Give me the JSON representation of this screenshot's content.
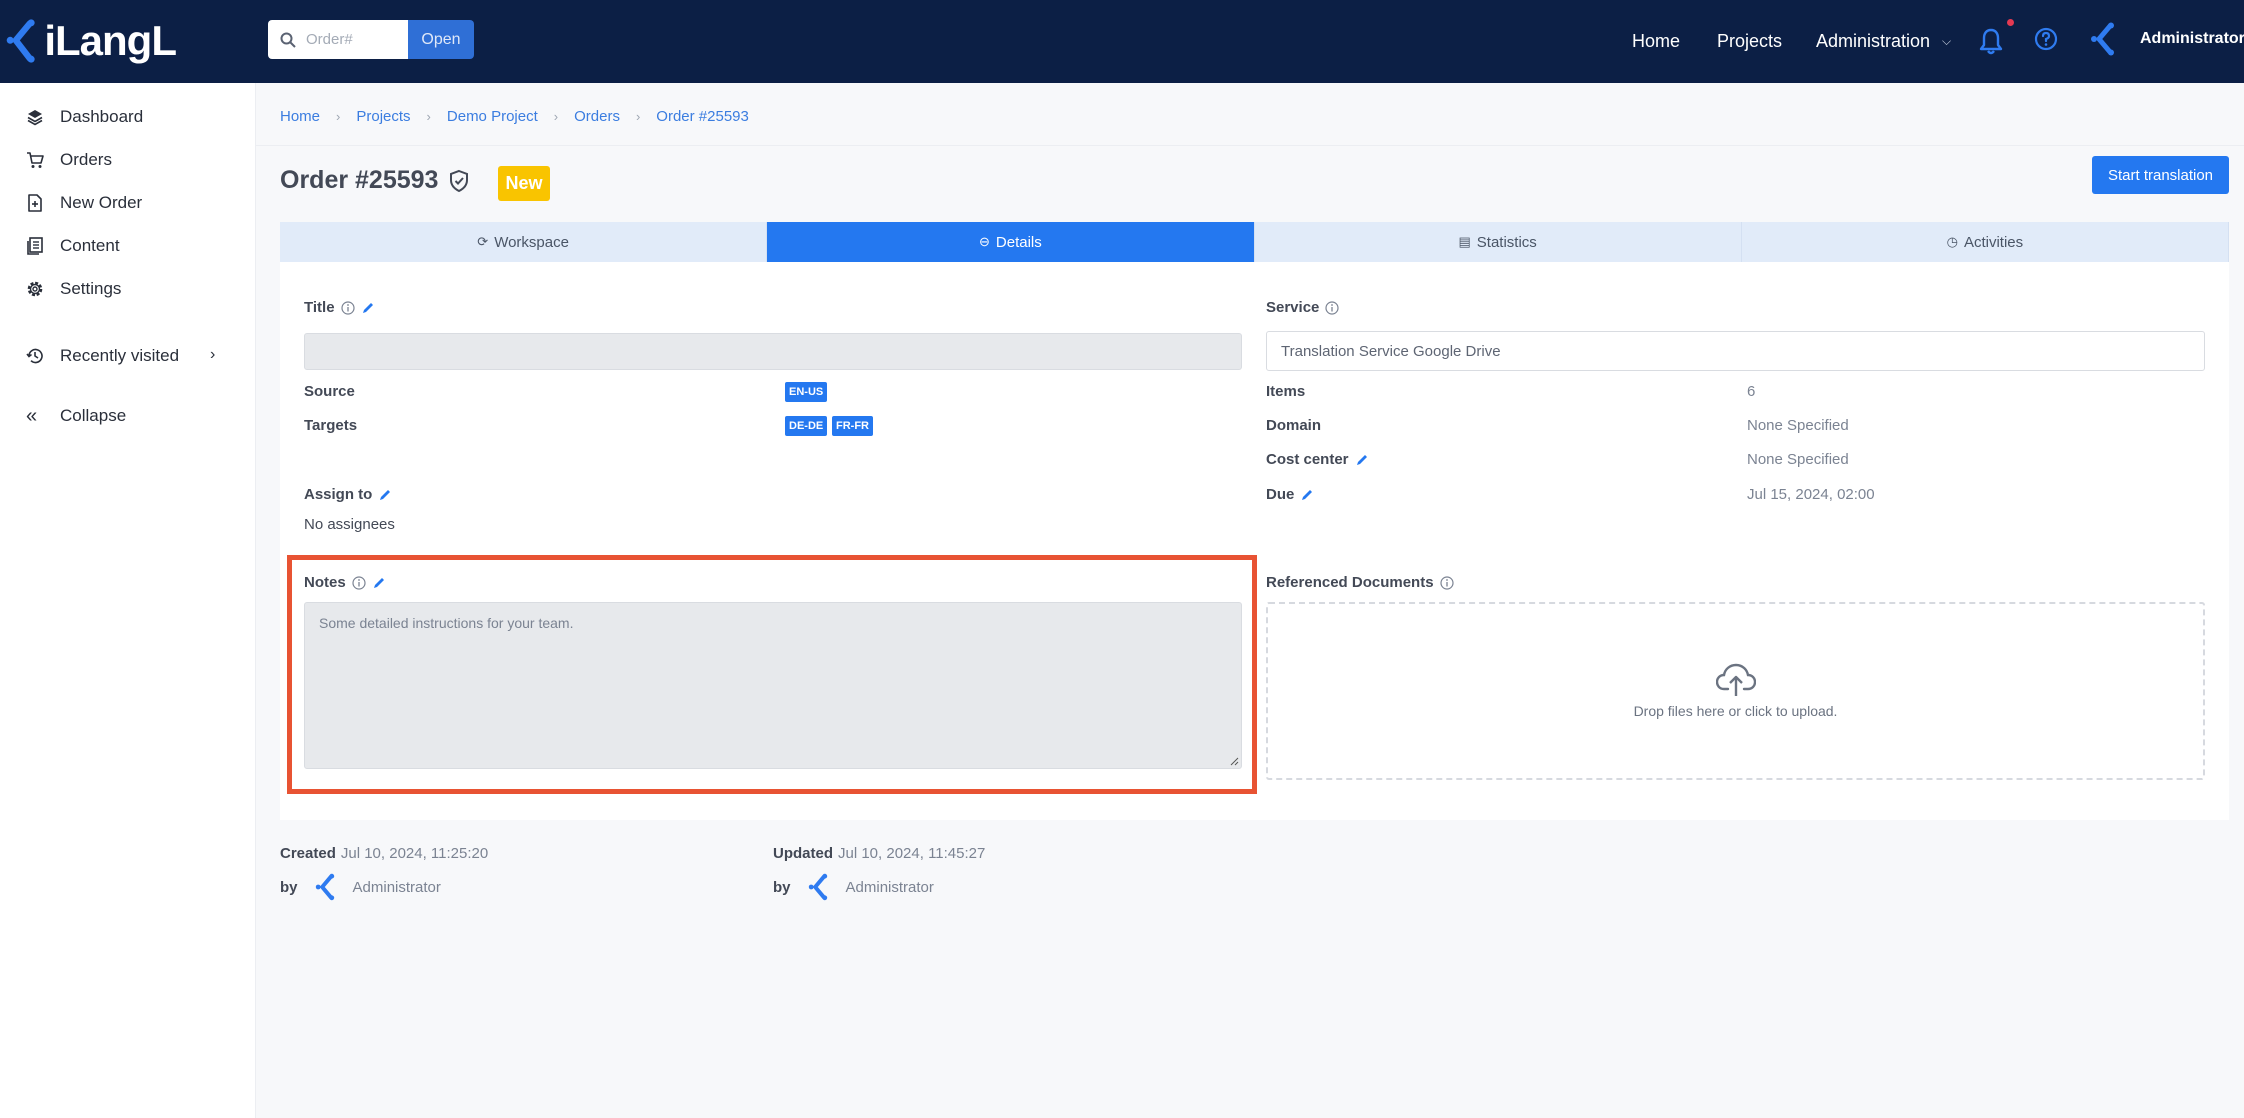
{
  "topbar": {
    "logo_text": "iLangL",
    "search_placeholder": "Order#",
    "open_label": "Open",
    "nav": {
      "home": "Home",
      "projects": "Projects",
      "administration": "Administration"
    },
    "user_name": "Administrator"
  },
  "sidebar": {
    "items": [
      {
        "label": "Dashboard",
        "icon": "layers-icon"
      },
      {
        "label": "Orders",
        "icon": "cart-icon"
      },
      {
        "label": "New Order",
        "icon": "new-document-icon"
      },
      {
        "label": "Content",
        "icon": "content-icon"
      },
      {
        "label": "Settings",
        "icon": "gear-icon"
      }
    ],
    "recently_visited": "Recently visited",
    "collapse": "Collapse"
  },
  "breadcrumb": [
    "Home",
    "Projects",
    "Demo Project",
    "Orders",
    "Order #25593"
  ],
  "page": {
    "title": "Order #25593",
    "status_badge": "New",
    "start_button": "Start translation"
  },
  "tabs": [
    {
      "label": "Workspace",
      "icon": "refresh-icon"
    },
    {
      "label": "Details",
      "icon": "minus-circle-icon"
    },
    {
      "label": "Statistics",
      "icon": "chart-icon"
    },
    {
      "label": "Activities",
      "icon": "history-icon"
    }
  ],
  "details": {
    "title_label": "Title",
    "title_value": "",
    "service_label": "Service",
    "service_value": "Translation Service Google Drive",
    "source_label": "Source",
    "source_tag": "EN-US",
    "targets_label": "Targets",
    "target_tags": [
      "DE-DE",
      "FR-FR"
    ],
    "items_label": "Items",
    "items_value": "6",
    "domain_label": "Domain",
    "domain_value": "None Specified",
    "cost_center_label": "Cost center",
    "cost_center_value": "None Specified",
    "due_label": "Due",
    "due_value": "Jul 15, 2024, 02:00",
    "assign_label": "Assign to",
    "assign_value": "No assignees",
    "notes_label": "Notes",
    "notes_placeholder": "Some detailed instructions for your team.",
    "ref_docs_label": "Referenced Documents",
    "dropzone_text": "Drop files here or click to upload."
  },
  "footer": {
    "created_label": "Created",
    "created_value": "Jul 10, 2024, 11:25:20",
    "updated_label": "Updated",
    "updated_value": "Jul 10, 2024, 11:45:27",
    "by_label": "by",
    "created_by": "Administrator",
    "updated_by": "Administrator"
  },
  "colors": {
    "topbar": "#0c1f45",
    "accent": "#2478f0",
    "badge_new": "#f9c400",
    "highlight_frame": "#e85333",
    "notification_dot": "#e53952"
  }
}
